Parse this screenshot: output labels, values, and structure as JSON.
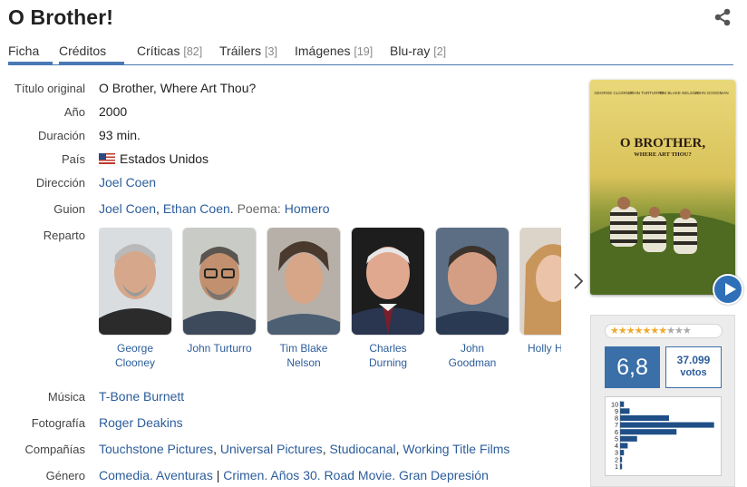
{
  "page": {
    "title": "O Brother!"
  },
  "tabs": [
    {
      "label": "Ficha",
      "count": ""
    },
    {
      "label": "Créditos",
      "count": ""
    },
    {
      "label": "Críticas",
      "count": "[82]"
    },
    {
      "label": "Tráilers",
      "count": "[3]"
    },
    {
      "label": "Imágenes",
      "count": "[19]"
    },
    {
      "label": "Blu-ray",
      "count": "[2]"
    }
  ],
  "details": {
    "original_title_label": "Título original",
    "original_title": "O Brother, Where Art Thou?",
    "year_label": "Año",
    "year": "2000",
    "duration_label": "Duración",
    "duration": "93 min.",
    "country_label": "País",
    "country": "Estados Unidos",
    "direction_label": "Dirección",
    "director": "Joel Coen",
    "script_label": "Guion",
    "writer_1": "Joel Coen",
    "writer_2": "Ethan Coen",
    "poem_label": "Poema:",
    "poem_author": "Homero",
    "cast_label": "Reparto",
    "music_label": "Música",
    "music": "T-Bone Burnett",
    "photo_label": "Fotografía",
    "photography": "Roger Deakins",
    "companies_label": "Compañías",
    "companies": [
      "Touchstone Pictures",
      "Universal Pictures",
      "Studiocanal",
      "Working Title Films"
    ],
    "genre_label": "Género",
    "genre": [
      "Comedia",
      "Aventuras",
      "Crimen",
      "Años 30",
      "Road Movie",
      "Gran Depresión"
    ]
  },
  "cast": [
    {
      "name_line1": "George",
      "name_line2": "Clooney"
    },
    {
      "name_line1": "John Turturro",
      "name_line2": ""
    },
    {
      "name_line1": "Tim Blake",
      "name_line2": "Nelson"
    },
    {
      "name_line1": "Charles",
      "name_line2": "Durning"
    },
    {
      "name_line1": "John Goodman",
      "name_line2": ""
    },
    {
      "name_line1": "Holly H",
      "name_line2": ""
    }
  ],
  "poster": {
    "credit_names": [
      "GEORGE CLOONEY",
      "JOHN TURTURRO",
      "TIM BLAKE NELSON",
      "JOHN GOODMAN"
    ],
    "title_line1": "O BROTHER,",
    "title_line2": "WHERE ART THOU?"
  },
  "rating": {
    "stars_filled": 7,
    "stars_total": 10,
    "average": "6,8",
    "votes": "37.099",
    "votes_label": "votos",
    "histogram_labels": [
      "10",
      "9",
      "8",
      "7",
      "6",
      "5",
      "4",
      "3",
      "2",
      "1"
    ],
    "histogram_values": [
      4,
      10,
      52,
      100,
      60,
      18,
      8,
      4,
      2,
      2
    ],
    "colors": {
      "accent": "#3a6fa8",
      "star": "#f0a92e",
      "link": "#2c5d9b"
    }
  }
}
